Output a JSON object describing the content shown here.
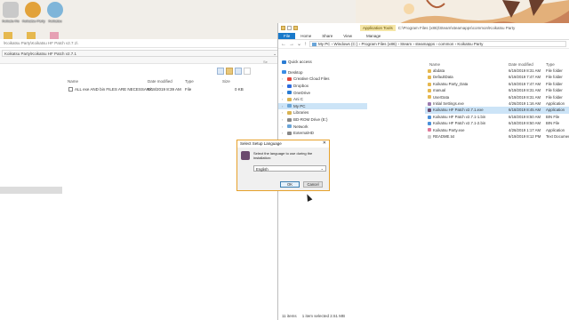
{
  "desktop": {
    "icons": [
      {
        "label": "Koikatu Ro",
        "color": "#c9c9c9"
      },
      {
        "label": "Koikatsu Party",
        "color": "#e2a23a"
      },
      {
        "label": "Koikatsu",
        "color": "#7fb5d9"
      }
    ],
    "folder_icons": [
      {
        "color": "#e6b84e"
      },
      {
        "color": "#e6b84e"
      },
      {
        "color": "#e6a0b4"
      }
    ]
  },
  "left_window": {
    "title_path": "\\Koikatsu Party\\Koikatsu HF Patch v2.7.1\\",
    "address": "Koikatsu Party\\Koikatsu HF Patch v2.7.1",
    "search_placeholder": "Se",
    "columns": [
      "Name",
      "Date modified",
      "Type",
      "Size"
    ],
    "rows": [
      {
        "name": "ALL exe AND bin FILES ARE NECESSARY",
        "date": "6/18/2019 8:39 AM",
        "type": "File",
        "size": "0 KB"
      }
    ]
  },
  "right_window": {
    "title_path": "C:\\Program Files (x86)\\Steam\\steamapps\\common\\Koikatsu Party",
    "app_tools": "Application Tools",
    "tabs": [
      "File",
      "Home",
      "Share",
      "View",
      "Manage"
    ],
    "breadcrumb": [
      "My PC",
      "Windows (C:)",
      "Program Files (x86)",
      "Steam",
      "steamapps",
      "common",
      "Koikatsu Party"
    ],
    "nav": [
      {
        "label": "Quick access",
        "top": true,
        "color": "#2b7cd3"
      },
      {
        "label": "Desktop",
        "top": true,
        "color": "#3a8ee6"
      },
      {
        "label": "Creative Cloud Files",
        "color": "#e0463c"
      },
      {
        "label": "Dropbox",
        "color": "#2d6cdf"
      },
      {
        "label": "OneDrive",
        "color": "#2b7cd3"
      },
      {
        "label": "Ani C",
        "color": "#d9b352"
      },
      {
        "label": "My PC",
        "color": "#6aa5d8",
        "selected": true
      },
      {
        "label": "Libraries",
        "color": "#d9b352"
      },
      {
        "label": "BD-ROM Drive (E:)",
        "color": "#888888"
      },
      {
        "label": "Network",
        "color": "#6aa5d8"
      },
      {
        "label": "ExternalHD",
        "color": "#888888"
      }
    ],
    "columns": [
      "Name",
      "Date modified",
      "Type"
    ],
    "files": [
      {
        "name": "abdata",
        "date": "6/19/2019 8:31 AM",
        "type": "File folder",
        "color": "#e6b84e"
      },
      {
        "name": "DefaultData",
        "date": "6/19/2019 7:47 AM",
        "type": "File folder",
        "color": "#e6b84e"
      },
      {
        "name": "Koikatsu Party_Data",
        "date": "6/19/2019 7:47 AM",
        "type": "File folder",
        "color": "#e6b84e"
      },
      {
        "name": "manual",
        "date": "6/19/2019 8:31 AM",
        "type": "File folder",
        "color": "#e6b84e"
      },
      {
        "name": "UserData",
        "date": "6/19/2019 8:31 AM",
        "type": "File folder",
        "color": "#e6b84e"
      },
      {
        "name": "Initial Settings.exe",
        "date": "4/26/2019 1:16 AM",
        "type": "Application",
        "color": "#9b7bb0"
      },
      {
        "name": "Koikatsu HF Patch v2.7.1.exe",
        "date": "6/18/2019 8:45 AM",
        "type": "Application",
        "color": "#6b4a6e",
        "selected": true
      },
      {
        "name": "Koikatsu HF Patch v2.7.1-1.bin",
        "date": "6/18/2019 8:50 AM",
        "type": "BIN File",
        "color": "#4a90d9"
      },
      {
        "name": "Koikatsu HF Patch v2.7.1-2.bin",
        "date": "6/18/2019 8:50 AM",
        "type": "BIN File",
        "color": "#4a90d9"
      },
      {
        "name": "Koikatsu Party.exe",
        "date": "4/26/2019 1:17 AM",
        "type": "Application",
        "color": "#e07a9a"
      },
      {
        "name": "README.txt",
        "date": "6/19/2019 8:12 PM",
        "type": "Text Document",
        "color": "#cccccc"
      }
    ],
    "status": {
      "items": "11 items",
      "selected": "1 item selected  2.51 MB"
    }
  },
  "dialog": {
    "title": "Select Setup Language",
    "message": "Select the language to use during the installation:",
    "language": "English",
    "ok": "OK",
    "cancel": "Cancel",
    "accent": "#e6a12b"
  }
}
